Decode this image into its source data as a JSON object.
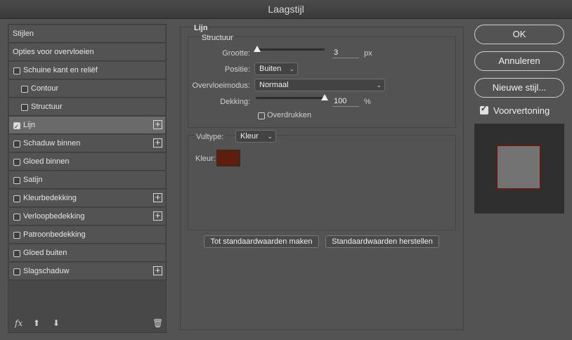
{
  "window": {
    "title": "Laagstijl"
  },
  "sidebar": {
    "items": [
      {
        "label": "Stijlen",
        "checkbox": false,
        "checked": false,
        "plus": false,
        "indent": false,
        "selected": false
      },
      {
        "label": "Opties voor overvloeien",
        "checkbox": false,
        "checked": false,
        "plus": false,
        "indent": false,
        "selected": false
      },
      {
        "label": "Schuine kant en reliëf",
        "checkbox": true,
        "checked": false,
        "plus": false,
        "indent": false,
        "selected": false
      },
      {
        "label": "Contour",
        "checkbox": true,
        "checked": false,
        "plus": false,
        "indent": true,
        "selected": false
      },
      {
        "label": "Structuur",
        "checkbox": true,
        "checked": false,
        "plus": false,
        "indent": true,
        "selected": false
      },
      {
        "label": "Lijn",
        "checkbox": true,
        "checked": true,
        "plus": true,
        "indent": false,
        "selected": true
      },
      {
        "label": "Schaduw binnen",
        "checkbox": true,
        "checked": false,
        "plus": true,
        "indent": false,
        "selected": false
      },
      {
        "label": "Gloed binnen",
        "checkbox": true,
        "checked": false,
        "plus": false,
        "indent": false,
        "selected": false
      },
      {
        "label": "Satijn",
        "checkbox": true,
        "checked": false,
        "plus": false,
        "indent": false,
        "selected": false
      },
      {
        "label": "Kleurbedekking",
        "checkbox": true,
        "checked": false,
        "plus": true,
        "indent": false,
        "selected": false
      },
      {
        "label": "Verloopbedekking",
        "checkbox": true,
        "checked": false,
        "plus": true,
        "indent": false,
        "selected": false
      },
      {
        "label": "Patroonbedekking",
        "checkbox": true,
        "checked": false,
        "plus": false,
        "indent": false,
        "selected": false
      },
      {
        "label": "Gloed buiten",
        "checkbox": true,
        "checked": false,
        "plus": false,
        "indent": false,
        "selected": false
      },
      {
        "label": "Slagschaduw",
        "checkbox": true,
        "checked": false,
        "plus": true,
        "indent": false,
        "selected": false
      }
    ],
    "footer": {
      "fx": "fx",
      "up_icon": "arrow-up-icon",
      "down_icon": "arrow-down-icon",
      "trash_icon": "trash-icon"
    }
  },
  "stroke": {
    "title": "Lijn",
    "structure": {
      "title": "Structuur",
      "size_label": "Grootte:",
      "size_value": "3",
      "size_unit": "px",
      "size_fraction": 0.02,
      "position_label": "Positie:",
      "position_value": "Buiten",
      "blend_label": "Overvloeimodus:",
      "blend_value": "Normaal",
      "opacity_label": "Dekking:",
      "opacity_value": "100",
      "opacity_unit": "%",
      "opacity_fraction": 1.0,
      "overprint_label": "Overdrukken",
      "overprint_checked": false
    },
    "fill": {
      "type_label": "Vultype:",
      "type_value": "Kleur",
      "color_label": "Kleur:",
      "color": "#5e1e0e"
    },
    "buttons": {
      "make_default": "Tot standaardwaarden maken",
      "reset_default": "Standaardwaarden herstellen"
    }
  },
  "actions": {
    "ok": "OK",
    "cancel": "Annuleren",
    "new_style": "Nieuwe stijl...",
    "preview_label": "Voorvertoning",
    "preview_checked": true
  }
}
